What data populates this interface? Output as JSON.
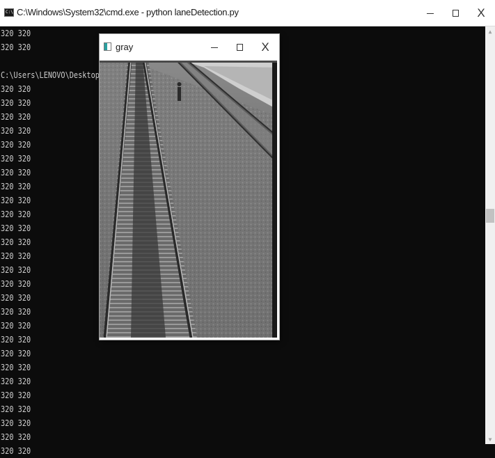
{
  "cmd_window": {
    "title": "C:\\Windows\\System32\\cmd.exe - python  laneDetection.py",
    "icon": "cmd-icon",
    "icon_text": "C:\\.",
    "buttons": {
      "minimize": "minimize-icon",
      "maximize": "maximize-icon",
      "close": "close-icon",
      "close_glyph": "X"
    }
  },
  "console": {
    "lines": [
      "320 320",
      "320 320",
      "",
      "C:\\Users\\LENOVO\\Desktop\\r                        n.py",
      "320 320",
      "320 320",
      "320 320",
      "320 320",
      "320 320",
      "320 320",
      "320 320",
      "320 320",
      "320 320",
      "320 320",
      "320 320",
      "320 320",
      "320 320",
      "320 320",
      "320 320",
      "320 320",
      "320 320",
      "320 320",
      "320 320",
      "320 320",
      "320 320",
      "320 320",
      "320 320",
      "320 320",
      "320 320",
      "320 320",
      "320 320"
    ]
  },
  "gray_window": {
    "title": "gray",
    "icon": "image-window-icon",
    "close_glyph": "X"
  },
  "colors": {
    "console_bg": "#0c0c0c",
    "console_text": "#cccccc",
    "titlebar_bg": "#ffffff"
  }
}
